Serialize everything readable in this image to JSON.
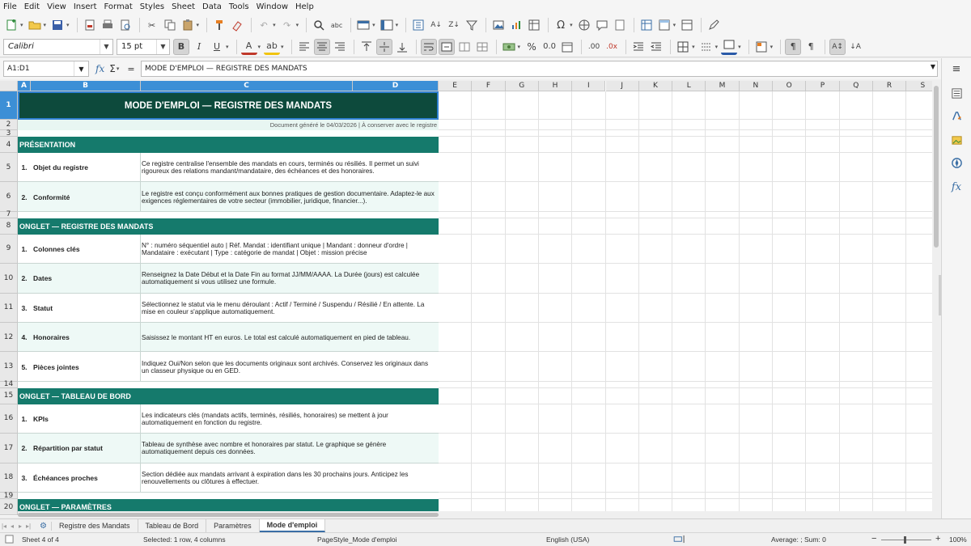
{
  "menu": [
    "File",
    "Edit",
    "View",
    "Insert",
    "Format",
    "Styles",
    "Sheet",
    "Data",
    "Tools",
    "Window",
    "Help"
  ],
  "toolbar": {
    "font_name": "Calibri",
    "font_size": "15 pt"
  },
  "formula_bar": {
    "name_box": "A1:D1",
    "content": "MODE D'EMPLOI — REGISTRE DES MANDATS"
  },
  "columns": [
    "A",
    "B",
    "C",
    "D",
    "E",
    "F",
    "G",
    "H",
    "I",
    "J",
    "K",
    "L",
    "M",
    "N",
    "O",
    "P",
    "Q",
    "R",
    "S"
  ],
  "sheet": {
    "title": "MODE D'EMPLOI — REGISTRE DES MANDATS",
    "subtitle": "Document généré le 04/03/2026  |  À conserver avec le registre",
    "sections": [
      {
        "heading": "PRÉSENTATION",
        "items": [
          {
            "num": "1.",
            "label": "Objet du registre",
            "desc": "Ce registre centralise l'ensemble des mandats en cours, terminés ou résiliés. Il permet un suivi rigoureux des relations mandant/mandataire, des échéances et des honoraires."
          },
          {
            "num": "2.",
            "label": "Conformité",
            "desc": "Le registre est conçu conformément aux bonnes pratiques de gestion documentaire. Adaptez-le aux exigences réglementaires de votre secteur (immobilier, juridique, financier...)."
          }
        ]
      },
      {
        "heading": "ONGLET — REGISTRE DES MANDATS",
        "items": [
          {
            "num": "1.",
            "label": "Colonnes clés",
            "desc": "N° : numéro séquentiel auto | Réf. Mandat : identifiant unique | Mandant : donneur d'ordre | Mandataire : exécutant | Type : catégorie de mandat | Objet : mission précise"
          },
          {
            "num": "2.",
            "label": "Dates",
            "desc": "Renseignez la Date Début et la Date Fin au format JJ/MM/AAAA. La Durée (jours) est calculée automatiquement si vous utilisez une formule."
          },
          {
            "num": "3.",
            "label": "Statut",
            "desc": "Sélectionnez le statut via le menu déroulant : Actif / Terminé / Suspendu / Résilié / En attente. La mise en couleur s'applique automatiquement."
          },
          {
            "num": "4.",
            "label": "Honoraires",
            "desc": "Saisissez le montant HT en euros. Le total est calculé automatiquement en pied de tableau."
          },
          {
            "num": "5.",
            "label": "Pièces jointes",
            "desc": "Indiquez Oui/Non selon que les documents originaux sont archivés. Conservez les originaux dans un classeur physique ou en GED."
          }
        ]
      },
      {
        "heading": "ONGLET — TABLEAU DE BORD",
        "items": [
          {
            "num": "1.",
            "label": "KPIs",
            "desc": "Les indicateurs clés (mandats actifs, terminés, résiliés, honoraires) se mettent à jour automatiquement en fonction du registre."
          },
          {
            "num": "2.",
            "label": "Répartition par statut",
            "desc": "Tableau de synthèse avec nombre et honoraires par statut. Le graphique se génère automatiquement depuis ces données."
          },
          {
            "num": "3.",
            "label": "Échéances proches",
            "desc": "Section dédiée aux mandats arrivant à expiration dans les 30 prochains jours. Anticipez les renouvellements ou clôtures à effectuer."
          }
        ]
      },
      {
        "heading": "ONGLET — PARAMÈTRES",
        "items": []
      }
    ]
  },
  "tabs": [
    "Registre des Mandats",
    "Tableau de Bord",
    "Paramètres",
    "Mode d'emploi"
  ],
  "active_tab": "Mode d'emploi",
  "status": {
    "sheet": "Sheet 4 of 4",
    "selection": "Selected: 1 row, 4 columns",
    "page_style": "PageStyle_Mode d'emploi",
    "language": "English (USA)",
    "summary": "Average: ; Sum: 0",
    "zoom": "100%"
  }
}
